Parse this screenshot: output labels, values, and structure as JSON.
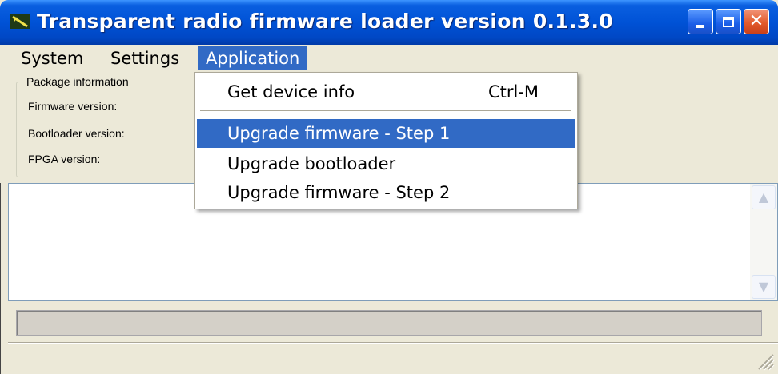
{
  "window": {
    "title": "Transparent radio firmware loader version 0.1.3.0",
    "icons": {
      "app": "antenna-icon",
      "minimize": "minimize-icon",
      "maximize": "maximize-icon",
      "close": "close-icon"
    }
  },
  "menubar": {
    "items": [
      {
        "label": "System"
      },
      {
        "label": "Settings"
      },
      {
        "label": "Application",
        "active": true
      }
    ]
  },
  "package_info": {
    "legend": "Package information",
    "firmware_label": "Firmware version:",
    "bootloader_label": "Bootloader version:",
    "fpga_label": "FPGA version:"
  },
  "application_menu": {
    "items": [
      {
        "label": "Get device info",
        "shortcut": "Ctrl-M"
      },
      {
        "label": "Upgrade firmware - Step 1",
        "highlighted": true
      },
      {
        "label": "Upgrade bootloader"
      },
      {
        "label": "Upgrade firmware - Step 2"
      }
    ]
  },
  "log": {
    "text": ""
  },
  "progress": {
    "value": 0
  },
  "colors": {
    "titlebar": "#0052d6",
    "highlight": "#316ac5",
    "background": "#ece9d8"
  }
}
